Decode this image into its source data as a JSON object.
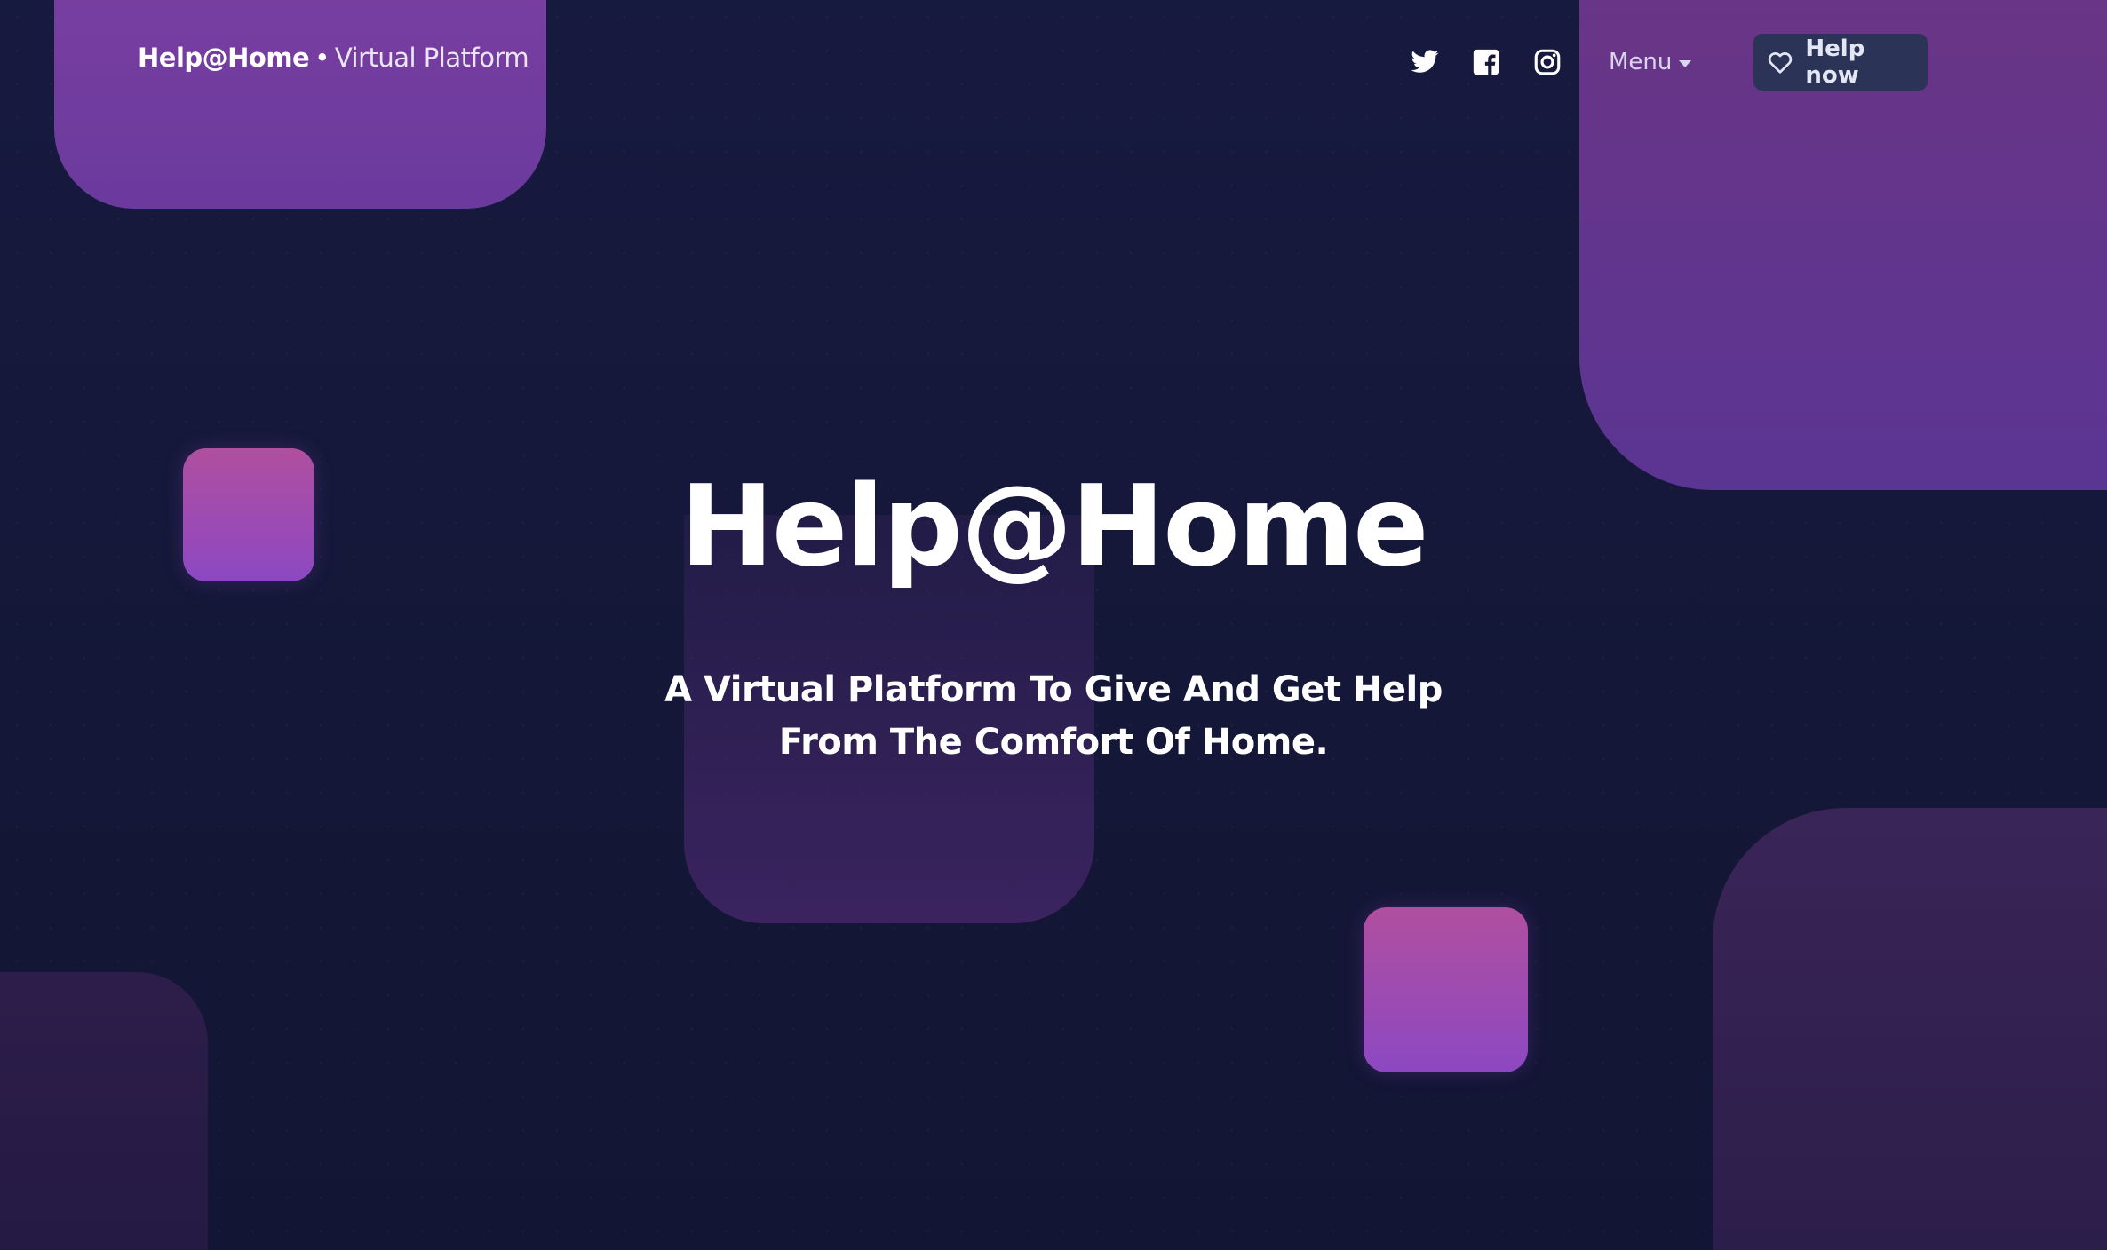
{
  "brand": {
    "name": "Help@Home",
    "separator": "•",
    "subtitle": "Virtual Platform"
  },
  "nav": {
    "social": [
      {
        "icon": "twitter-icon"
      },
      {
        "icon": "facebook-icon"
      },
      {
        "icon": "instagram-icon"
      }
    ],
    "menu_label": "Menu",
    "help_button_label": "Help now",
    "help_button_icon": "heart-icon"
  },
  "hero": {
    "title": "Help@Home",
    "subtitle_line1": "A Virtual Platform To Give And Get Help",
    "subtitle_line2": "From The Comfort Of Home."
  },
  "colors": {
    "background": "#151838",
    "accent_purple": "#8c48c2",
    "accent_pink": "#b04f9f",
    "button_bg": "#2b3356"
  }
}
